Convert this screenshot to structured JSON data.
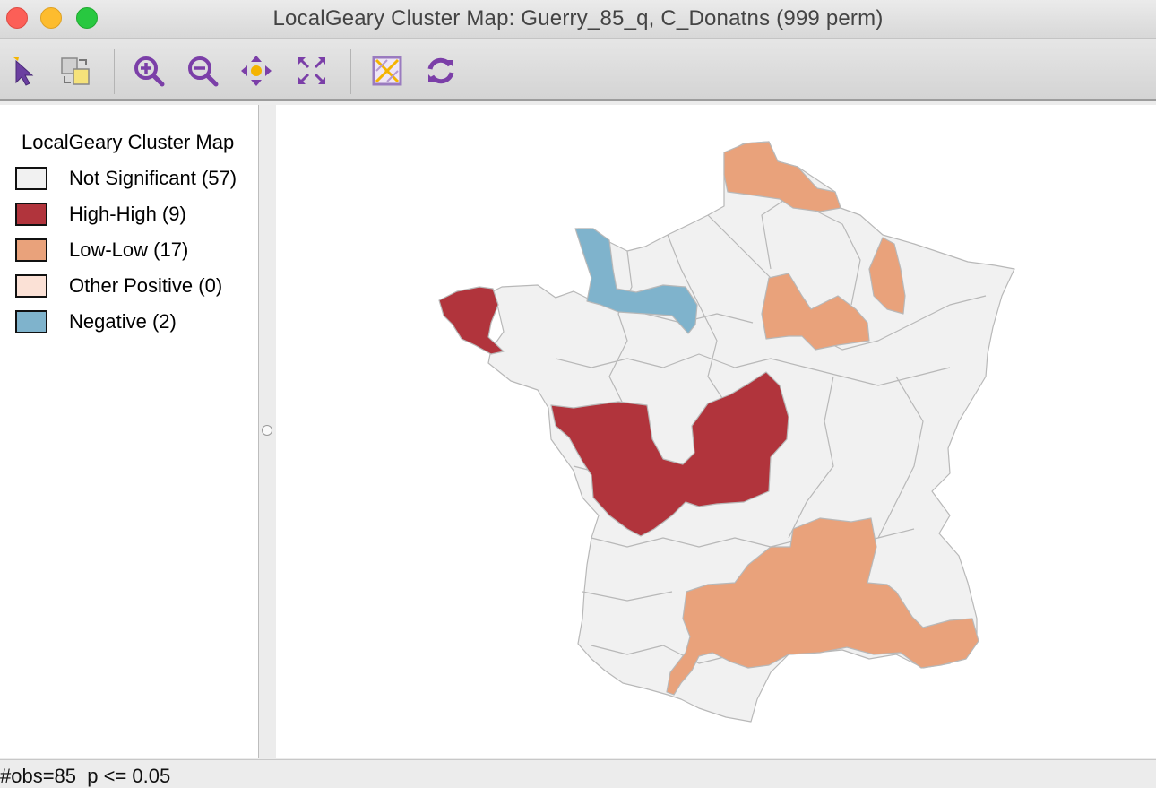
{
  "window": {
    "title": "LocalGeary Cluster Map: Guerry_85_q, C_Donatns (999 perm)"
  },
  "toolbar": {
    "buttons": [
      {
        "icon": "select-arrow-icon"
      },
      {
        "icon": "copy-selection-icon"
      },
      {
        "icon": "zoom-in-icon"
      },
      {
        "icon": "zoom-out-icon"
      },
      {
        "icon": "pan-icon"
      },
      {
        "icon": "fit-to-extent-icon"
      },
      {
        "icon": "basemap-icon"
      },
      {
        "icon": "refresh-icon"
      }
    ]
  },
  "legend": {
    "title": "LocalGeary Cluster Map",
    "items": [
      {
        "label": "Not Significant (57)",
        "color": "#f1f1f1"
      },
      {
        "label": "High-High (9)",
        "color": "#b1343c"
      },
      {
        "label": "Low-Low (17)",
        "color": "#e9a27b"
      },
      {
        "label": "Other Positive (0)",
        "color": "#fbe1d6"
      },
      {
        "label": "Negative (2)",
        "color": "#7fb3cc"
      }
    ]
  },
  "status": {
    "text": "#obs=85  p <= 0.05"
  }
}
